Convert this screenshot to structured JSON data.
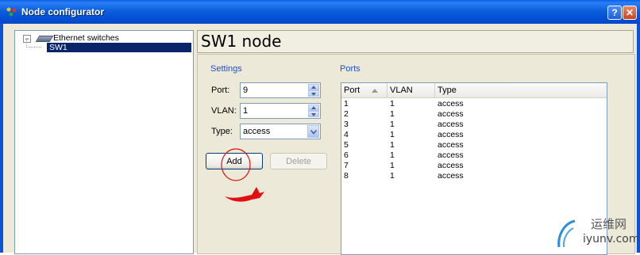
{
  "window": {
    "title": "Node configurator",
    "help_btn": "?",
    "close_btn": "✕"
  },
  "tree": {
    "root": {
      "label": "Ethernet switches",
      "expander": "−"
    },
    "child": {
      "label": "SW1",
      "selected": true
    }
  },
  "node": {
    "title": "SW1 node"
  },
  "settings": {
    "group_label": "Settings",
    "port": {
      "label": "Port:",
      "value": "9"
    },
    "vlan": {
      "label": "VLAN:",
      "value": "1"
    },
    "type": {
      "label": "Type:",
      "value": "access"
    },
    "add_label": "Add",
    "delete_label": "Delete"
  },
  "ports": {
    "group_label": "Ports",
    "columns": [
      "Port",
      "VLAN",
      "Type"
    ],
    "rows": [
      {
        "port": "1",
        "vlan": "1",
        "type": "access"
      },
      {
        "port": "2",
        "vlan": "1",
        "type": "access"
      },
      {
        "port": "3",
        "vlan": "1",
        "type": "access"
      },
      {
        "port": "4",
        "vlan": "1",
        "type": "access"
      },
      {
        "port": "5",
        "vlan": "1",
        "type": "access"
      },
      {
        "port": "6",
        "vlan": "1",
        "type": "access"
      },
      {
        "port": "7",
        "vlan": "1",
        "type": "access"
      },
      {
        "port": "8",
        "vlan": "1",
        "type": "access"
      }
    ]
  },
  "watermark": {
    "cn": "运维网",
    "en": "iyunv.com"
  },
  "colors": {
    "titlebar": "#0550d6",
    "selection": "#0a246a",
    "group_label": "#2051c8",
    "annotation": "#e01010"
  }
}
